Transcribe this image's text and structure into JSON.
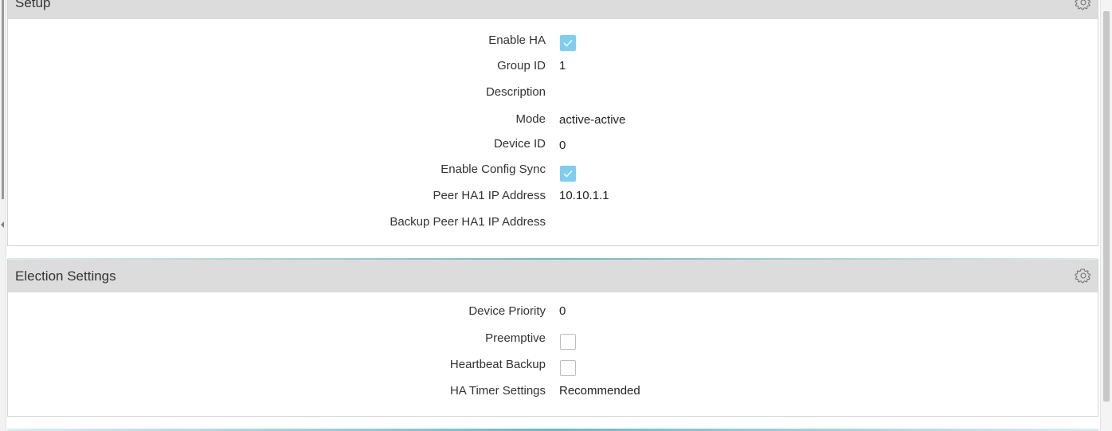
{
  "setup": {
    "title": "Setup",
    "gear_icon": "gear-icon",
    "fields": {
      "enable_ha": {
        "label": "Enable HA",
        "checked": true
      },
      "group_id": {
        "label": "Group ID",
        "value": "1"
      },
      "description": {
        "label": "Description",
        "value": ""
      },
      "mode": {
        "label": "Mode",
        "value": "active-active"
      },
      "device_id": {
        "label": "Device ID",
        "value": "0"
      },
      "enable_config_sync": {
        "label": "Enable Config Sync",
        "checked": true
      },
      "peer_ha1_ip": {
        "label": "Peer HA1 IP Address",
        "value": "10.10.1.1"
      },
      "backup_peer_ha1_ip": {
        "label": "Backup Peer HA1 IP Address",
        "value": ""
      }
    }
  },
  "election": {
    "title": "Election Settings",
    "gear_icon": "gear-icon",
    "fields": {
      "device_priority": {
        "label": "Device Priority",
        "value": "0"
      },
      "preemptive": {
        "label": "Preemptive",
        "checked": false
      },
      "heartbeat_backup": {
        "label": "Heartbeat Backup",
        "checked": false
      },
      "ha_timer_settings": {
        "label": "HA Timer Settings",
        "value": "Recommended"
      }
    }
  },
  "colors": {
    "header_bg": "#dcdcdc",
    "checkbox_checked": "#7fcdf0",
    "accent_line": "#6fb7c5"
  }
}
